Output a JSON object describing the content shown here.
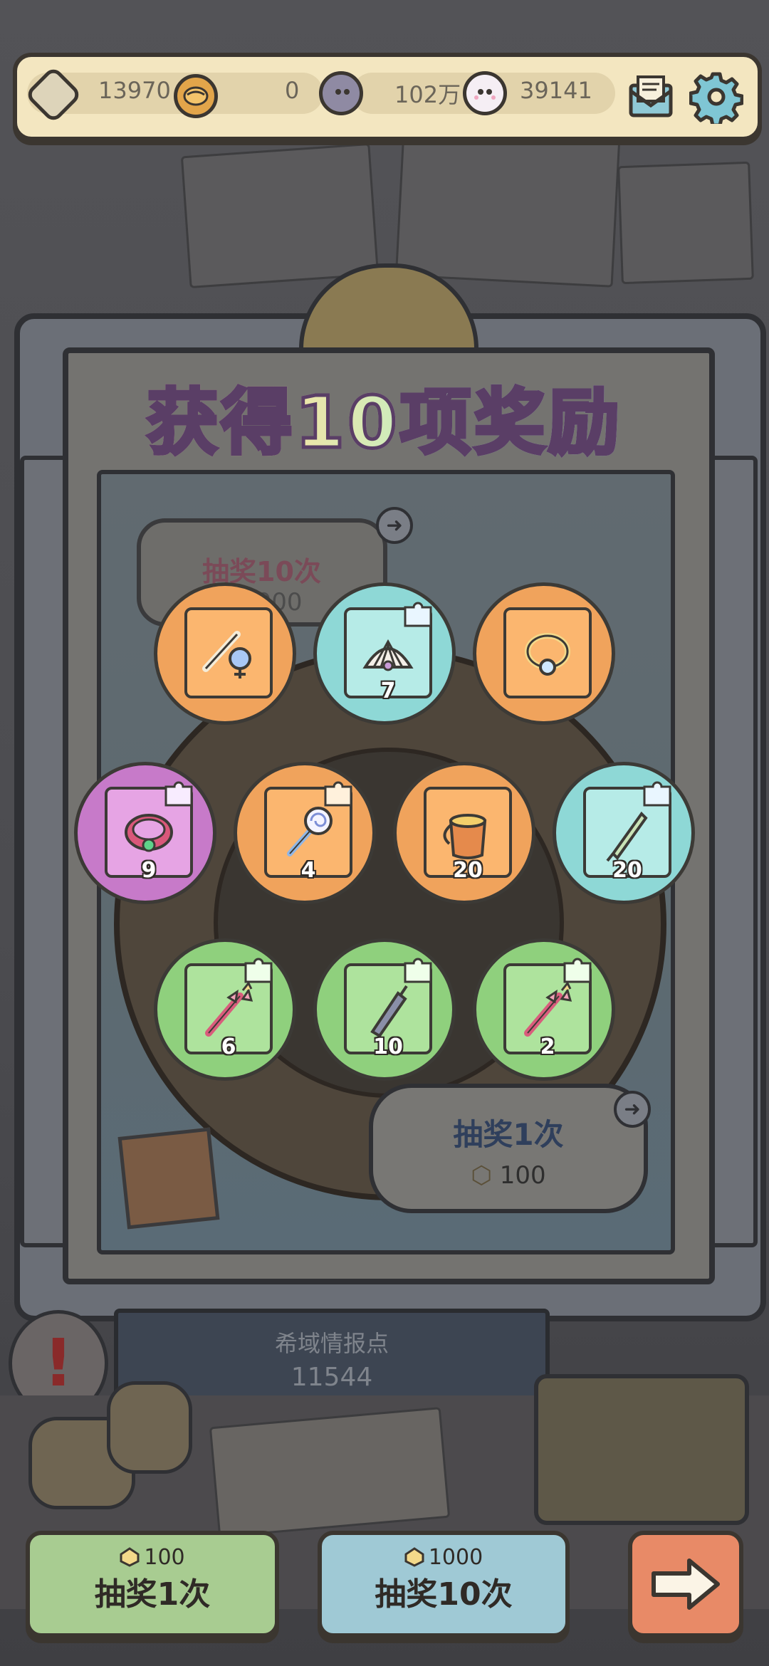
{
  "resources": {
    "gem": "13970",
    "coin": "0",
    "orb": "102万",
    "spirit": "39141"
  },
  "overlay": {
    "title": "获得10项奖励"
  },
  "background": {
    "draw10_label": "抽奖10次",
    "draw10_cost": "1000",
    "draw1_label": "抽奖1次",
    "draw1_cost": "100",
    "info_title": "希域情报点",
    "info_value": "11544",
    "alert_mark": "!"
  },
  "rewards": [
    {
      "item": "ornate-wand",
      "rarity": "orange",
      "count": ""
    },
    {
      "item": "seashell-fragment",
      "rarity": "cyan",
      "count": "7"
    },
    {
      "item": "pearl-ring",
      "rarity": "orange",
      "count": ""
    },
    {
      "item": "gem-bracelet-fragment",
      "rarity": "purple",
      "count": "9"
    },
    {
      "item": "lollipop-wand-fragment",
      "rarity": "orange",
      "count": "4"
    },
    {
      "item": "paint-bucket",
      "rarity": "orange",
      "count": "20"
    },
    {
      "item": "umbrella-fragment",
      "rarity": "cyan",
      "count": "20"
    },
    {
      "item": "bow-wand-fragment",
      "rarity": "green",
      "count": "6"
    },
    {
      "item": "closed-umbrella-fragment",
      "rarity": "green",
      "count": "10"
    },
    {
      "item": "bow-wand-fragment",
      "rarity": "green",
      "count": "2"
    }
  ],
  "buttons": {
    "draw1": {
      "label": "抽奖1次",
      "cost": "100"
    },
    "draw10": {
      "label": "抽奖10次",
      "cost": "1000"
    },
    "next_icon": "arrow-right-icon"
  },
  "colors": {
    "orange": "#f0a35c",
    "cyan": "#8ed8d6",
    "green": "#8fd07d",
    "purple": "#c77ac9"
  }
}
